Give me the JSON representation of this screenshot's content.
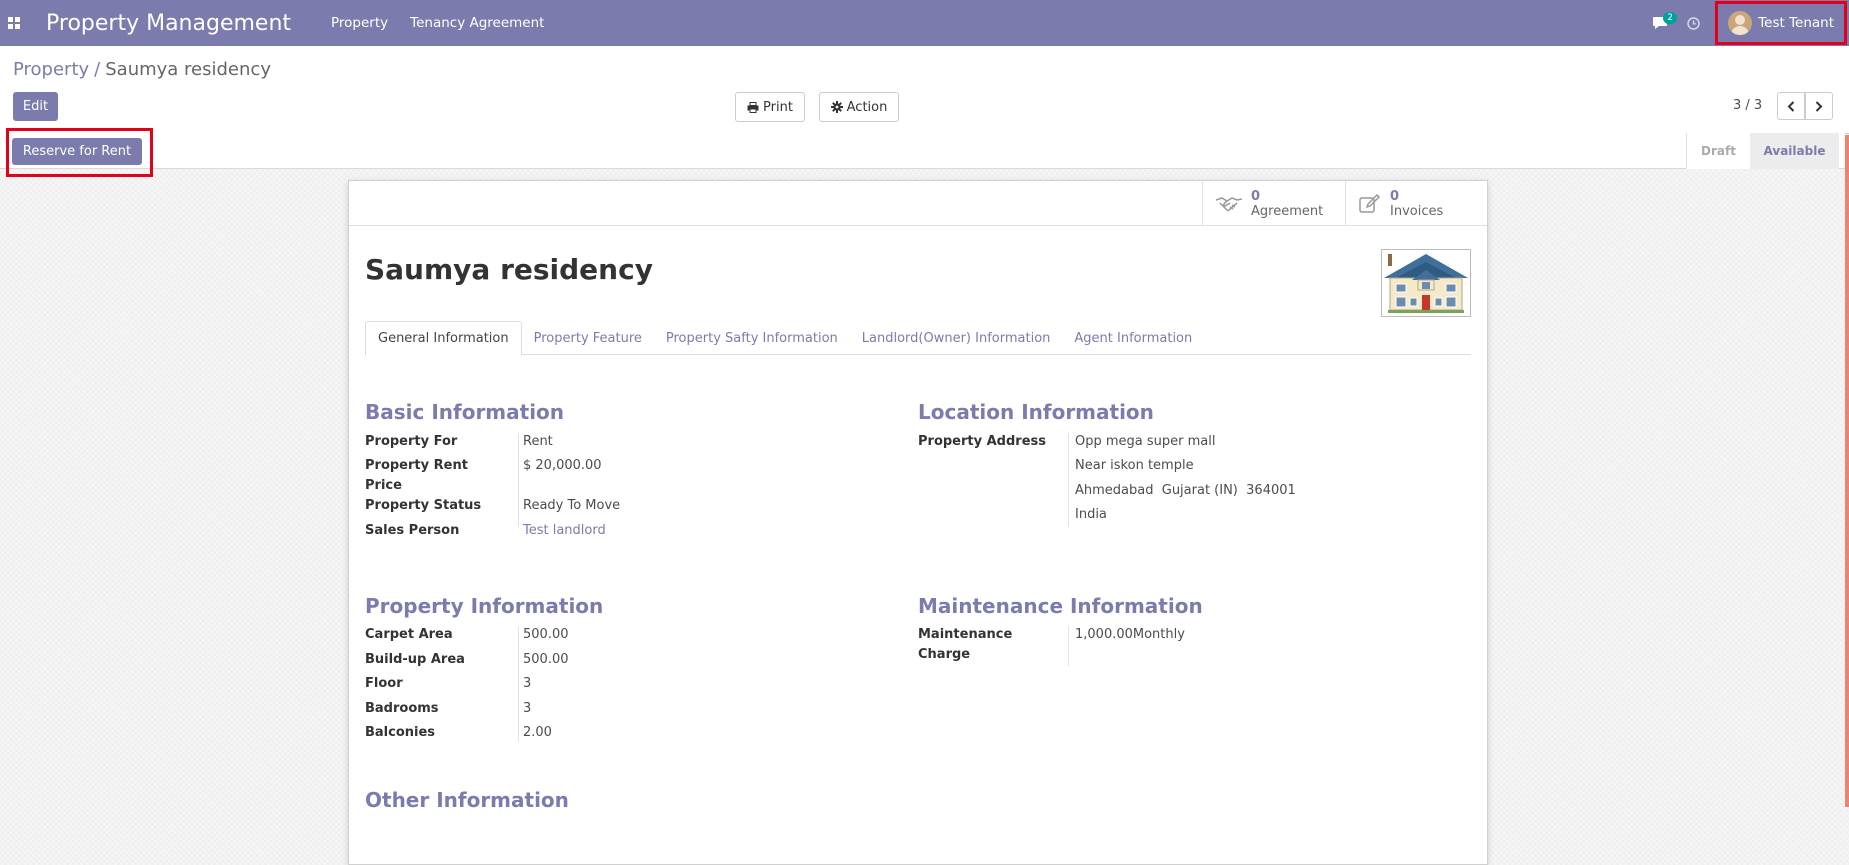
{
  "navbar": {
    "app_title": "Property Management",
    "menu": [
      "Property",
      "Tenancy Agreement"
    ],
    "chat_count": "2",
    "user_name": "Test Tenant",
    "bg_color": "#7c7bad"
  },
  "breadcrumb": {
    "parent": "Property",
    "separator": "/",
    "current": "Saumya residency"
  },
  "toolbar": {
    "edit_label": "Edit",
    "print_label": "Print",
    "action_label": "Action",
    "pager_value": "3 / 3"
  },
  "statusbar": {
    "reserve_label": "Reserve for Rent",
    "steps": [
      "Draft",
      "Available"
    ],
    "current_step": "Available"
  },
  "stat_buttons": [
    {
      "value": "0",
      "label": "Agreement",
      "icon": "handshake-icon"
    },
    {
      "value": "0",
      "label": "Invoices",
      "icon": "edit-icon"
    }
  ],
  "record": {
    "name": "Saumya residency"
  },
  "tabs": [
    "General Information",
    "Property Feature",
    "Property Safty Information",
    "Landlord(Owner) Information",
    "Agent Information"
  ],
  "sections": {
    "basic": {
      "title": "Basic Information",
      "property_for_label": "Property For",
      "property_for": "Rent",
      "rent_label_1": "Property Rent",
      "rent_label_2": "Price",
      "rent": "$ 20,000.00",
      "status_label": "Property Status",
      "status": "Ready To Move",
      "sales_label": "Sales Person",
      "sales": "Test landlord"
    },
    "location": {
      "title": "Location Information",
      "address_label": "Property Address",
      "address_lines": [
        "Opp mega super mall",
        "Near iskon temple",
        "Ahmedabad  Gujarat (IN)  364001",
        "India"
      ]
    },
    "property": {
      "title": "Property Information",
      "carpet_label": "Carpet Area",
      "carpet": "500.00",
      "buildup_label": "Build-up Area",
      "buildup": "500.00",
      "floor_label": "Floor",
      "floor": "3",
      "bedrooms_label": "Badrooms",
      "bedrooms": "3",
      "balconies_label": "Balconies",
      "balconies": "2.00"
    },
    "maintenance": {
      "title": "Maintenance Information",
      "charge_label_1": "Maintenance",
      "charge_label_2": "Charge",
      "charge": "1,000.00Monthly"
    },
    "other": {
      "title": "Other Information"
    }
  }
}
